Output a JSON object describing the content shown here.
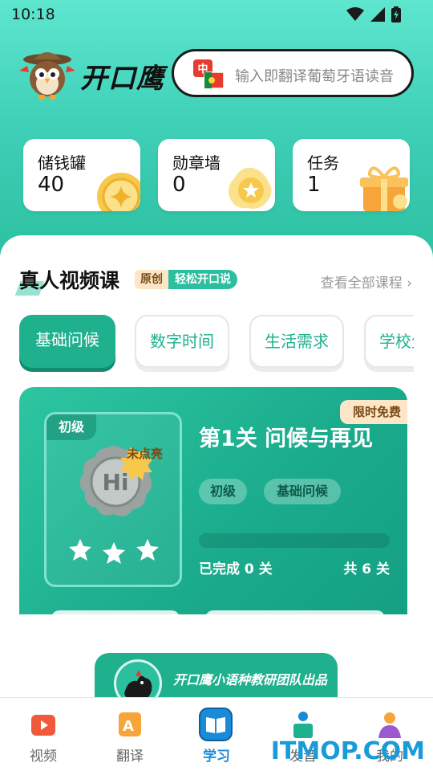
{
  "status_bar": {
    "time": "10:18"
  },
  "app": {
    "name": "开口鹰"
  },
  "search": {
    "flag_label": "中",
    "placeholder": "输入即翻译葡萄牙语读音"
  },
  "stats": [
    {
      "title": "储钱罐",
      "value": "40"
    },
    {
      "title": "勋章墙",
      "value": "0"
    },
    {
      "title": "任务",
      "value": "1"
    }
  ],
  "section": {
    "title": "真人视频课",
    "badge_original": "原创",
    "badge_easy": "轻松开口说",
    "view_all": "查看全部课程 ›"
  },
  "tabs": [
    {
      "label": "基础问候",
      "active": true
    },
    {
      "label": "数字时间",
      "active": false
    },
    {
      "label": "生活需求",
      "active": false
    },
    {
      "label": "学校生活",
      "active": false
    }
  ],
  "course_card": {
    "free_tag": "限时免费",
    "level_tag": "初级",
    "medal_text": "Hi",
    "not_lit": "未点亮",
    "title": "第1关 问候与再见",
    "pills": [
      "初级",
      "基础问候"
    ],
    "progress": 0,
    "done_text": "已完成 0 关",
    "total_text": "共 6 关"
  },
  "team_banner": {
    "text": "开口鹰小语种教研团队出品"
  },
  "nav": [
    {
      "label": "视频",
      "icon": "video-icon",
      "active": false
    },
    {
      "label": "翻译",
      "icon": "translate-icon",
      "active": false
    },
    {
      "label": "学习",
      "icon": "book-icon",
      "active": true
    },
    {
      "label": "发音",
      "icon": "pronounce-icon",
      "active": false
    },
    {
      "label": "我的",
      "icon": "profile-icon",
      "active": false
    }
  ],
  "watermark": "ITMOP.COM",
  "colors": {
    "accent": "#1fb08e",
    "header_top": "#5ee6cf",
    "nav_active": "#1a8bd9",
    "tag_bg": "#fde6c8"
  }
}
